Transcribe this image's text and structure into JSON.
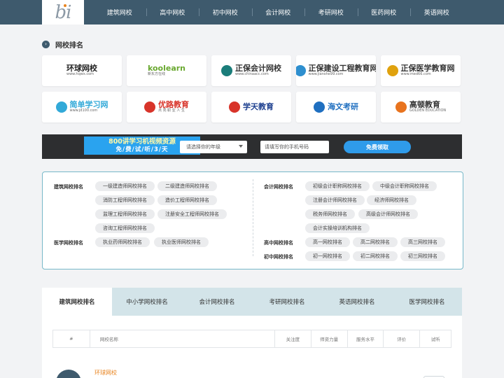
{
  "header": {
    "logo_text": "bi",
    "nav": [
      "建筑网校",
      "高中网校",
      "初中网校",
      "会计网校",
      "考研网校",
      "医药网校",
      "英语网校"
    ]
  },
  "section": {
    "icon": "chevron-right-icon",
    "title": "网校排名"
  },
  "schools": [
    {
      "name": "环球网校",
      "sub": "www.hqwx.com",
      "color": "#222222",
      "mark": "#ffffff"
    },
    {
      "name": "koolearn",
      "sub": "新东方在线",
      "color": "#69a82f",
      "mark": "#ffffff"
    },
    {
      "name": "正保会计网校",
      "sub": "www.chinaacc.com",
      "color": "#333333",
      "mark": "#1b7d7a"
    },
    {
      "name": "正保建设工程教育网",
      "sub": "www.jianshe99.com",
      "color": "#333333",
      "mark": "#2e8fcf"
    },
    {
      "name": "正保医学教育网",
      "sub": "www.med66.com",
      "color": "#333333",
      "mark": "#e0a20e"
    },
    {
      "name": "简单学习网",
      "sub": "www.jd100.com",
      "color": "#32a9d8",
      "mark": "#32a9d8"
    },
    {
      "name": "优路教育",
      "sub": "点 亮 职 业 人 生",
      "color": "#d8342a",
      "mark": "#d8342a"
    },
    {
      "name": "学天教育",
      "sub": "",
      "color": "#1d3f8f",
      "mark": "#d8342a"
    },
    {
      "name": "海文考研",
      "sub": "",
      "color": "#1f6fc0",
      "mark": "#1f6fc0"
    },
    {
      "name": "高顿教育",
      "sub": "GOLDEN EDUCATION",
      "color": "#333333",
      "mark": "#e8731e"
    }
  ],
  "banner": {
    "promo_line1": "800讲学习机视频资源",
    "promo_line2": "免/费/试/听/3/天",
    "grade_select": "请选择你的年级",
    "phone_placeholder": "请填写你的手机号码",
    "submit": "免费领取"
  },
  "rankings": {
    "left": [
      {
        "category": "建筑网校排名",
        "items": [
          "一级建造师网校排名",
          "二级建造师网校排名",
          "消防工程师网校排名",
          "造价工程师网校排名",
          "监理工程师网校排名",
          "注册安全工程师网校排名",
          "咨询工程师网校排名"
        ]
      },
      {
        "category": "医学网校排名",
        "items": [
          "执业药师网校排名",
          "执业医师网校排名"
        ]
      }
    ],
    "right": [
      {
        "category": "会计网校排名",
        "items": [
          "初级会计职称网校排名",
          "中级会计职称网校排名",
          "注册会计师网校排名",
          "经济师网校排名",
          "税务师网校排名",
          "高级会计师网校排名",
          "会计实操培训机构排名"
        ]
      },
      {
        "category": "高中网校排名",
        "items": [
          "高一网校排名",
          "高二网校排名",
          "高三网校排名"
        ]
      },
      {
        "category": "初中网校排名",
        "items": [
          "初一网校排名",
          "初二网校排名",
          "初三网校排名"
        ]
      }
    ]
  },
  "tabs": [
    "建筑网校排名",
    "中小学网校排名",
    "会计网校排名",
    "考研网校排名",
    "英语网校排名",
    "医学网校排名"
  ],
  "active_tab": 0,
  "table": {
    "headers": [
      "#",
      "网校名称",
      "关注度",
      "师资力量",
      "服务水平",
      "评价",
      "试听"
    ],
    "first_row_name": "环球网校"
  },
  "colors": {
    "nav_bg": "#3e5a6d",
    "accent_blue": "#2f9bea",
    "accent_orange": "#e8831e",
    "tab_bg": "#d3e4e9"
  }
}
